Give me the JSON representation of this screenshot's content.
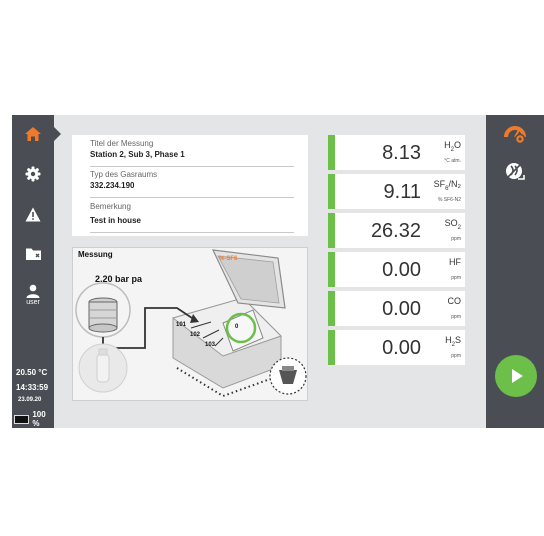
{
  "sidebar": {
    "items": [
      {
        "name": "home",
        "icon": "home-icon"
      },
      {
        "name": "settings",
        "icon": "gear-icon"
      },
      {
        "name": "warnings",
        "icon": "warning-icon"
      },
      {
        "name": "files",
        "icon": "folder-icon"
      },
      {
        "name": "user",
        "icon": "user-icon",
        "label": "user"
      }
    ],
    "active_color": "#f07a2a"
  },
  "status": {
    "temperature": "20.50 °C",
    "time": "14:33:59",
    "date": "23.09.20",
    "battery": "100 %"
  },
  "info": {
    "fields": [
      {
        "label": "Titel der Messung",
        "value": "Station 2, Sub 3, Phase 1"
      },
      {
        "label": "Typ des Gasraums",
        "value": "332.234.190"
      },
      {
        "label": "Bemerkung",
        "value": "Test in house"
      }
    ]
  },
  "diagram": {
    "title": "Messung",
    "pressure": "2.20 bar pa",
    "lid_label": "%-SF6",
    "ports": [
      "101",
      "102",
      "103"
    ],
    "gauge": "0"
  },
  "measurements": [
    {
      "value": "8.13",
      "unit_main": "H",
      "unit_subscript": "2",
      "unit_tail": "O",
      "sub": "°C atm."
    },
    {
      "value": "9.11",
      "unit_main": "SF",
      "unit_subscript": "6",
      "unit_tail": "/N₂",
      "sub": "% SF6-N2"
    },
    {
      "value": "26.32",
      "unit_main": "SO",
      "unit_subscript": "2",
      "unit_tail": "",
      "sub": "ppm"
    },
    {
      "value": "0.00",
      "unit_main": "HF",
      "unit_subscript": "",
      "unit_tail": "",
      "sub": "ppm"
    },
    {
      "value": "0.00",
      "unit_main": "CO",
      "unit_subscript": "",
      "unit_tail": "",
      "sub": "ppm"
    },
    {
      "value": "0.00",
      "unit_main": "H",
      "unit_subscript": "2",
      "unit_tail": "S",
      "sub": "ppm"
    }
  ],
  "rightbar": {
    "items": [
      {
        "name": "gauge-settings",
        "icon": "gauge-gear-icon"
      },
      {
        "name": "no-flow",
        "icon": "flow-off-icon"
      },
      {
        "name": "start",
        "icon": "play-icon"
      }
    ]
  },
  "colors": {
    "sidebar_bg": "#4a4e54",
    "accent_green": "#6cc04a",
    "accent_orange": "#f07a2a",
    "screen_bg": "#e3e5e7"
  }
}
